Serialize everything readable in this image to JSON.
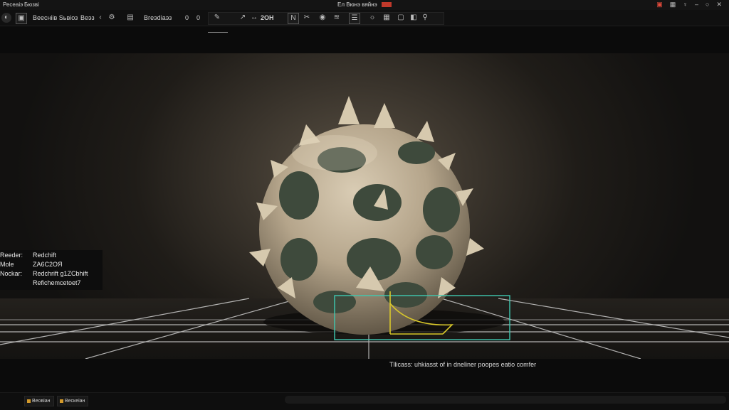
{
  "menubar": {
    "items": [
      "Ресеаіэ",
      "Бюзві"
    ],
    "title": "Ел Вюнэ вяйнэ"
  },
  "toolbar": {
    "left_label": "Веесніів Sьвіоз",
    "mode_label": "Веэз",
    "panel_label": "Вгеэdіаэз",
    "value_a": "0",
    "value_b": "0",
    "count_label": "2ОН"
  },
  "overlay": {
    "rows": [
      {
        "key": "Reeder:",
        "value": "Redchift"
      },
      {
        "key": "Mole",
        "value": "ZA6C2OЯ"
      },
      {
        "key": "Nockar:",
        "value": "Redchrift g1ZCbhift"
      },
      {
        "key": "",
        "value": "Refichemcetoet7"
      }
    ]
  },
  "caption": "Tllicass: uhkiasst of in dneliner poopes eatio comfer",
  "bottom_tabs": [
    "Веовіан",
    "Вескеіан"
  ],
  "colors": {
    "selection": "#3fc9b1",
    "annotation": "#d9c82a",
    "record": "#c0392b",
    "tab_accent": "#d39a2b"
  }
}
